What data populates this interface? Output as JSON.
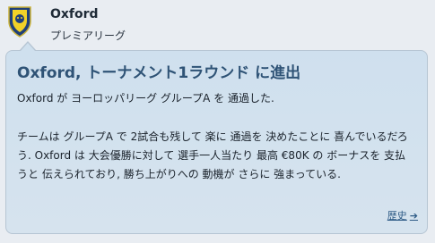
{
  "header": {
    "team_name": "Oxford",
    "league": "プレミアリーグ",
    "crest_icon": "club-crest-icon"
  },
  "news": {
    "title": "Oxford, トーナメント1ラウンド に進出",
    "paragraph1": "Oxford が ヨーロッパリーグ グループA を 通過した.",
    "paragraph2": "チームは グループA で 2試合も残して 楽に 通過を 決めたことに 喜んでいるだろう. Oxford は 大会優勝に対して 選手一人当たり 最高 €80K の ボーナスを 支払うと 伝えられており, 勝ち上がりへの 動機が さらに 強まっている.",
    "history_link": "歴史",
    "history_icon": "arrow-right-icon"
  },
  "colors": {
    "title": "#2f5376",
    "link": "#2e5b86",
    "card_bg": "#d2e1ee"
  }
}
